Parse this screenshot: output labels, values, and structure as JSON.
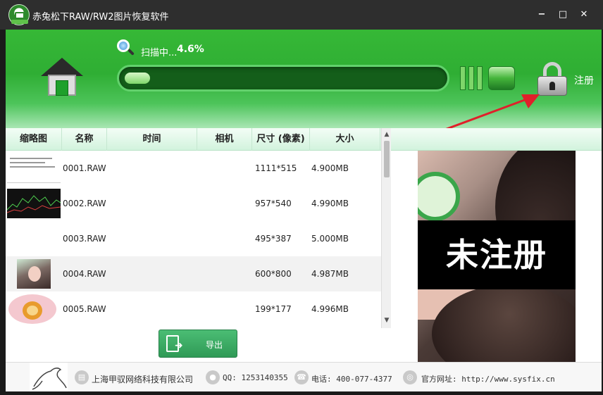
{
  "window": {
    "title": "赤兔松下RAW/RW2图片恢复软件",
    "min_label": "−",
    "max_label": "□",
    "close_label": "✕"
  },
  "header": {
    "scan_status": "扫描中...",
    "scan_percent": "4.6%",
    "progress": 0.046,
    "register_label": "注册"
  },
  "table": {
    "columns": [
      "缩略图",
      "名称",
      "时间",
      "相机",
      "尺寸 (像素)",
      "大小"
    ],
    "rows": [
      {
        "name": "0001.RAW",
        "time": "",
        "camera": "",
        "size_px": "1111*515",
        "size": "4.900MB",
        "thumb": "document"
      },
      {
        "name": "0002.RAW",
        "time": "",
        "camera": "",
        "size_px": "957*540",
        "size": "4.990MB",
        "thumb": "chart"
      },
      {
        "name": "0003.RAW",
        "time": "",
        "camera": "",
        "size_px": "495*387",
        "size": "5.000MB",
        "thumb": "blank"
      },
      {
        "name": "0004.RAW",
        "time": "",
        "camera": "",
        "size_px": "600*800",
        "size": "4.987MB",
        "thumb": "portrait"
      },
      {
        "name": "0005.RAW",
        "time": "",
        "camera": "",
        "size_px": "199*177",
        "size": "4.996MB",
        "thumb": "lion"
      }
    ]
  },
  "preview": {
    "overlay_text": "未注册"
  },
  "export": {
    "label": "导出"
  },
  "footer": {
    "company": "上海甲驭网络科技有限公司",
    "qq": "QQ: 1253140355",
    "phone": "电话: 400-077-4377",
    "website": "官方网址: http://www.sysfix.cn"
  },
  "colors": {
    "header_green": "#2fae34",
    "progress_track": "#145e1a",
    "export_green": "#3aa862",
    "annotation_arrow": "#e0202a"
  }
}
